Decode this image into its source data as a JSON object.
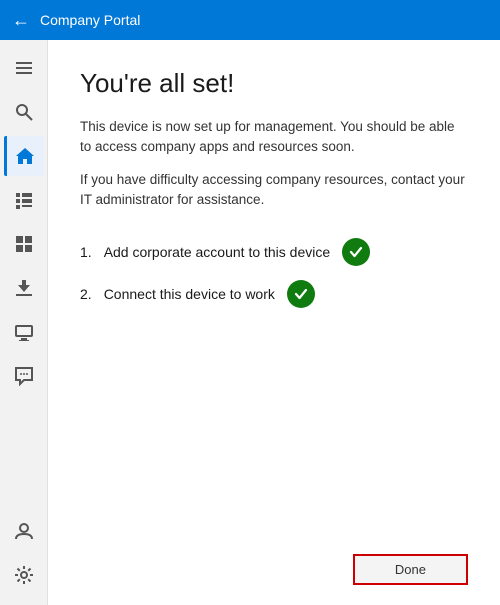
{
  "topbar": {
    "title": "Company Portal",
    "back_label": "←"
  },
  "sidebar": {
    "items": [
      {
        "name": "hamburger",
        "icon": "☰",
        "active": false
      },
      {
        "name": "search",
        "icon": "🔍",
        "active": false
      },
      {
        "name": "home",
        "icon": "⌂",
        "active": true
      },
      {
        "name": "list",
        "icon": "≡",
        "active": false
      },
      {
        "name": "grid",
        "icon": "⊞",
        "active": false
      },
      {
        "name": "download",
        "icon": "⬇",
        "active": false
      },
      {
        "name": "device",
        "icon": "🖥",
        "active": false
      },
      {
        "name": "chat",
        "icon": "💬",
        "active": false
      }
    ],
    "bottom_items": [
      {
        "name": "account",
        "icon": "👤"
      },
      {
        "name": "settings",
        "icon": "⚙"
      }
    ]
  },
  "content": {
    "title": "You're all set!",
    "description1": "This device is now set up for management.  You should be able to access company apps and resources soon.",
    "description2": "If you have difficulty accessing company resources, contact your IT administrator for assistance.",
    "checklist": [
      {
        "number": "1.",
        "label": "Add corporate account to this device"
      },
      {
        "number": "2.",
        "label": "Connect this device to work"
      }
    ],
    "done_button": "Done"
  }
}
